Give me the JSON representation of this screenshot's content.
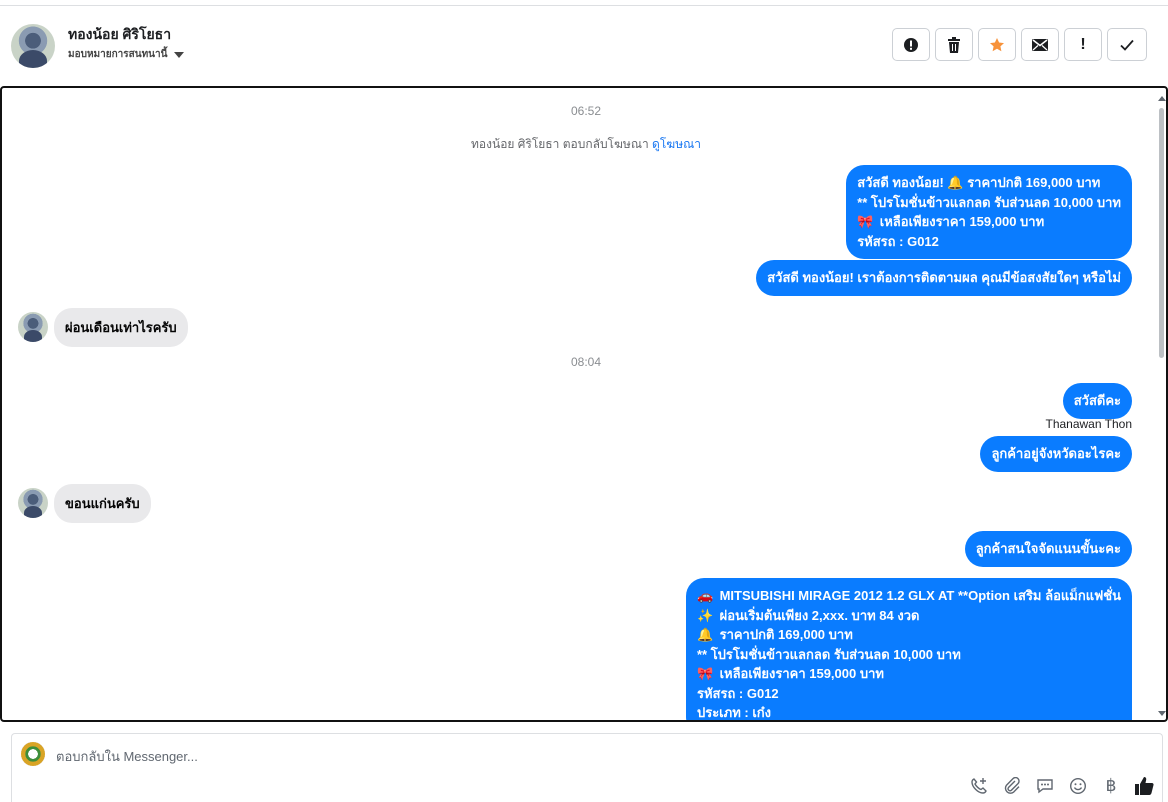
{
  "header": {
    "name": "ทองน้อย ศิริโยธา",
    "assign_label": "มอบหมายการสนทนานี้",
    "actions": [
      {
        "name": "spam-icon",
        "glyph": ""
      },
      {
        "name": "trash-icon",
        "glyph": ""
      },
      {
        "name": "star-icon",
        "glyph": ""
      },
      {
        "name": "mail-icon",
        "glyph": ""
      },
      {
        "name": "exclamation-icon",
        "glyph": "!"
      },
      {
        "name": "check-icon",
        "glyph": "✓"
      }
    ]
  },
  "chat": {
    "time1": "06:52",
    "notice_text": "ทองน้อย ศิริโยธา ตอบกลับโฆษณา",
    "notice_link": "ดูโฆษณา",
    "msg1": {
      "line1_text": "สวัสดี ทองน้อย! ",
      "line1_emoji": "🔔",
      "line1_tail": " ราคาปกติ 169,000 บาท",
      "line2": "** โปรโมชั่นข้าวแลกลด รับส่วนลด 10,000 บาท",
      "line3_emoji": "🎀",
      "line3": " เหลือเพียงราคา 159,000 บาท",
      "line4": " รหัสรถ : G012"
    },
    "msg2": "สวัสดี ทองน้อย! เราต้องการติดตามผล คุณมีข้อสงสัยใดๆ หรือไม่",
    "in1": "ผ่อนเดือนเท่าไรครับ",
    "time2": "08:04",
    "msg3": "สวัสดีคะ",
    "sender": "Thanawan Thon",
    "msg4": "ลูกค้าอยู่จังหวัดอะไรคะ",
    "in2": "ขอนแก่นครับ",
    "msg5": "ลูกค้าสนใจจัดแนนขั้นะคะ",
    "msg6": {
      "l1_emoji": "🚗",
      "l1": " MITSUBISHI MIRAGE 2012 1.2 GLX AT **Option เสริม ล้อแม็กแฟชั่น",
      "l2_emoji": "✨",
      "l2": " ผ่อนเริ่มต้นเพียง 2,xxx. บาท 84 งวด",
      "l3_emoji": "🔔",
      "l3": "  ราคาปกติ 169,000 บาท",
      "l4": "** โปรโมชั่นข้าวแลกลด รับส่วนลด 10,000 บาท",
      "l5_emoji": "🎀",
      "l5": " เหลือเพียงราคา 159,000 บาท",
      "l6": "  รหัสรถ : G012",
      "l7": "  ประเภท : เก๋ง"
    }
  },
  "composer": {
    "placeholder": "ตอบกลับใน Messenger...",
    "baht_symbol": "฿"
  },
  "colors": {
    "outgoing_bubble": "#0a7cff",
    "incoming_bubble": "#e9e9eb",
    "star": "#f7923a"
  }
}
